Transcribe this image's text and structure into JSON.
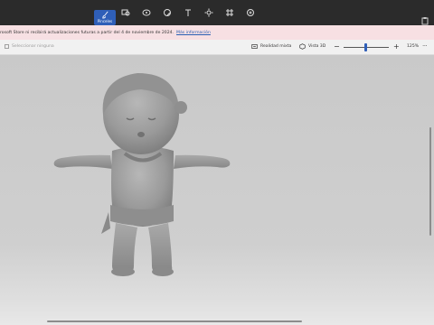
{
  "toolbar": {
    "tools": [
      {
        "id": "brushes",
        "icon": "brush-icon",
        "label": "Pinceles",
        "active": true
      },
      {
        "id": "shapes2d",
        "icon": "2d-shapes-icon",
        "label": "",
        "active": false
      },
      {
        "id": "shapes3d",
        "icon": "3d-shapes-icon",
        "label": "",
        "active": false
      },
      {
        "id": "stickers",
        "icon": "sticker-icon",
        "label": "",
        "active": false
      },
      {
        "id": "text",
        "icon": "text-icon",
        "label": "",
        "active": false
      },
      {
        "id": "effects",
        "icon": "effects-icon",
        "label": "",
        "active": false
      },
      {
        "id": "canvas",
        "icon": "canvas-icon",
        "label": "",
        "active": false
      },
      {
        "id": "library",
        "icon": "3d-library-icon",
        "label": "",
        "active": false
      }
    ],
    "right_icon": "paste-icon"
  },
  "banner": {
    "message": "rosoft Store ni recibirá actualizaciones futuras a partir del 4 de noviembre de 2024.",
    "link": "Más información"
  },
  "subbar": {
    "select_placeholder": "Seleccionar ninguna",
    "mixed_reality": "Realidad mixta",
    "view3d": "Vista 3D",
    "zoom_minus": "−",
    "zoom_plus": "+",
    "zoom_value": "125%",
    "zoom_level": 0.48,
    "more": "···"
  },
  "colors": {
    "toolbar_bg": "#2b2b2b",
    "active_tool": "#2f5fb8",
    "banner_bg": "#f7e0e3",
    "link": "#2a5fb3",
    "model": "#9b9b9b"
  }
}
